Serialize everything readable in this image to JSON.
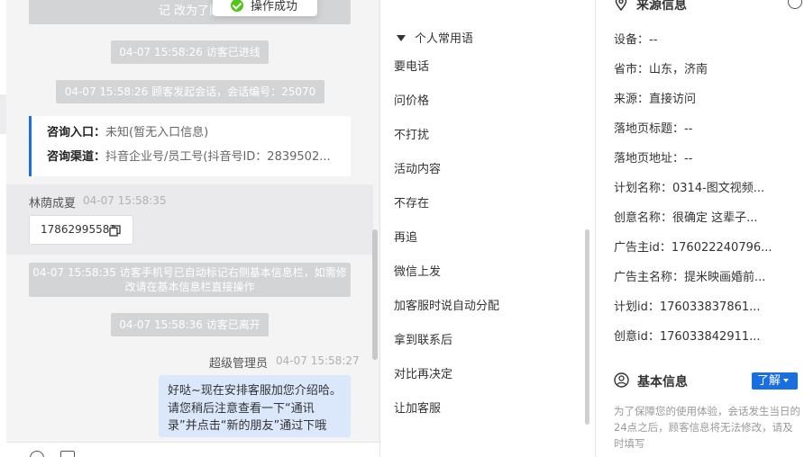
{
  "toast": {
    "text": "操作成功",
    "icon": "check-circle-icon",
    "color": "#52c41a"
  },
  "chat": {
    "top_cut_text": "记 改为了顾",
    "system_messages": [
      "04-07 15:58:26 访客已进线",
      "04-07 15:58:26 顾客发起会话，会话编号：25070",
      "04-07 15:58:35 访客手机号已自动标记右侧基本信息栏，如需修改请在基本信息栏直接操作",
      "04-07 15:58:36 访客已离开"
    ],
    "consult_card": {
      "entry_label": "咨询入口：",
      "entry_value": "未知(暂无入口信息)",
      "channel_label": "咨询渠道：",
      "channel_value": "抖音企业号/员工号(抖音号ID：2839502..."
    },
    "visitor": {
      "name": "林荫成夏",
      "time": "04-07 15:58:35",
      "phone": "17862995582"
    },
    "admin": {
      "name": "超级管理员",
      "time": "04-07 15:58:27",
      "message": "好哒~现在安排客服加您介绍哈。请您稍后注意查看一下“通讯录”并点击“新的朋友”通过下哦"
    },
    "accent_color": "#1a6fe0"
  },
  "phrases": {
    "group_title": "个人常用语",
    "items": [
      "要电话",
      "问价格",
      "不打扰",
      "活动内容",
      "不存在",
      "再追",
      "微信上发",
      "加客服时说自动分配",
      "拿到联系后",
      "对比再决定",
      "让加客服"
    ]
  },
  "info": {
    "source_title": "来源信息",
    "rows": [
      {
        "label": "设备：",
        "value": "--"
      },
      {
        "label": "省市：",
        "value": "山东，济南"
      },
      {
        "label": "来源：",
        "value": "直接访问"
      },
      {
        "label": "落地页标题：",
        "value": "--"
      },
      {
        "label": "落地页地址：",
        "value": "--"
      },
      {
        "label": "计划名称：",
        "value": "0314-图文视频..."
      },
      {
        "label": "创意名称：",
        "value": "很确定 这辈子..."
      },
      {
        "label": "广告主id：",
        "value": "176022240796..."
      },
      {
        "label": "广告主名称：",
        "value": "提米映画婚前..."
      },
      {
        "label": "计划id：",
        "value": "176033837861..."
      },
      {
        "label": "创意id：",
        "value": "176033842911..."
      }
    ],
    "basic_title": "基本信息",
    "learn_button": "了解",
    "notice": "为了保障您的使用体验，会话发生当日的24点之后，顾客信息将无法修改，请及时填写",
    "button_color": "#1a6fe0"
  }
}
